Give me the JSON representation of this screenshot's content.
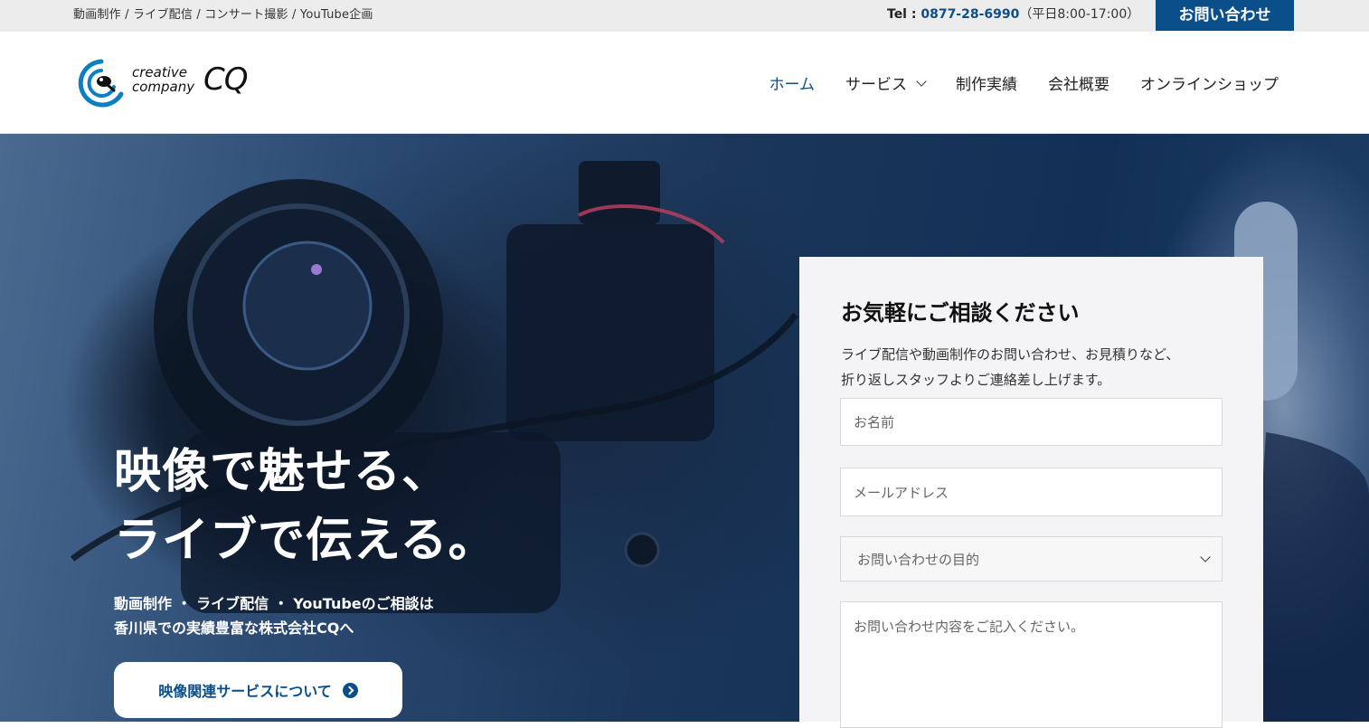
{
  "topbar": {
    "services": "動画制作 / ライブ配信 / コンサート撮影 / YouTube企画",
    "tel_label": "Tel : ",
    "tel_number": "0877-28-6990",
    "tel_hours": "（平日8:00-17:00）",
    "contact_label": "お問い合わせ"
  },
  "logo": {
    "line1": "creative",
    "line2": "company",
    "mark": "CQ"
  },
  "nav": {
    "items": [
      {
        "label": "ホーム"
      },
      {
        "label": "サービス"
      },
      {
        "label": "制作実績"
      },
      {
        "label": "会社概要"
      },
      {
        "label": "オンラインショップ"
      }
    ]
  },
  "hero": {
    "title_line1": "映像で魅せる、",
    "title_line2": "ライブで伝える。",
    "sub_line1": "動画制作 ・ ライブ配信 ・ YouTubeのご相談は",
    "sub_line2": "香川県での実績豊富な株式会社CQへ",
    "button_label": "映像関連サービスについて"
  },
  "form": {
    "title": "お気軽にご相談ください",
    "desc_line1": "ライブ配信や動画制作のお問い合わせ、お見積りなど、",
    "desc_line2": "折り返しスタッフよりご連絡差し上げます。",
    "name_placeholder": "お名前",
    "email_placeholder": "メールアドレス",
    "purpose_selected": "お問い合わせの目的",
    "message_placeholder": "お問い合わせ内容をご記入ください。"
  },
  "colors": {
    "brand": "#0b4f8a",
    "topbar_bg": "#ececec",
    "form_bg": "#f4f4f6"
  }
}
